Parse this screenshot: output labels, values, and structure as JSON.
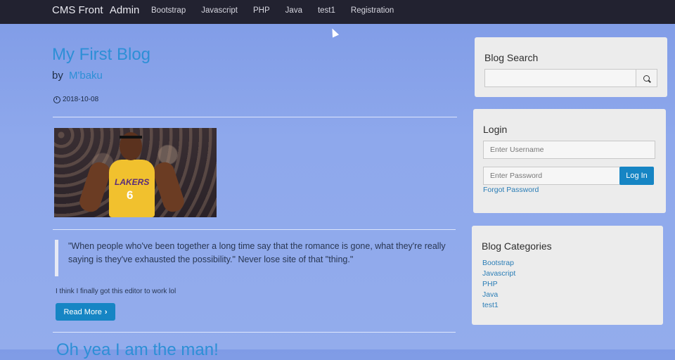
{
  "navbar": {
    "brand_left": "CMS Front",
    "brand_right": "Admin",
    "links": [
      "Bootstrap",
      "Javascript",
      "PHP",
      "Java",
      "test1",
      "Registration"
    ]
  },
  "post": {
    "title": "My First Blog",
    "by": "by",
    "author": "M'baku",
    "date": "2018-10-08",
    "image_jersey_text": "LAKERS",
    "image_jersey_number": "6",
    "quote": "\"When people who've been together a long time say that the romance is gone, what they're really saying is they've exhausted the possibility.\" Never lose site of that \"thing.\"",
    "body": "I think I finally got this editor to work lol",
    "read_more": "Read More"
  },
  "next_post": {
    "title": "Oh yea I am the man!"
  },
  "sidebar": {
    "search": {
      "title": "Blog Search",
      "placeholder": ""
    },
    "login": {
      "title": "Login",
      "username_placeholder": "Enter Username",
      "password_placeholder": "Enter Password",
      "button": "Log In",
      "forgot": "Forgot Password"
    },
    "categories": {
      "title": "Blog Categories",
      "items": [
        "Bootstrap",
        "Javascript",
        "PHP",
        "Java",
        "test1"
      ]
    }
  },
  "colors": {
    "navbar_bg": "#222230",
    "accent": "#1685c4",
    "link": "#2d8fd6"
  }
}
